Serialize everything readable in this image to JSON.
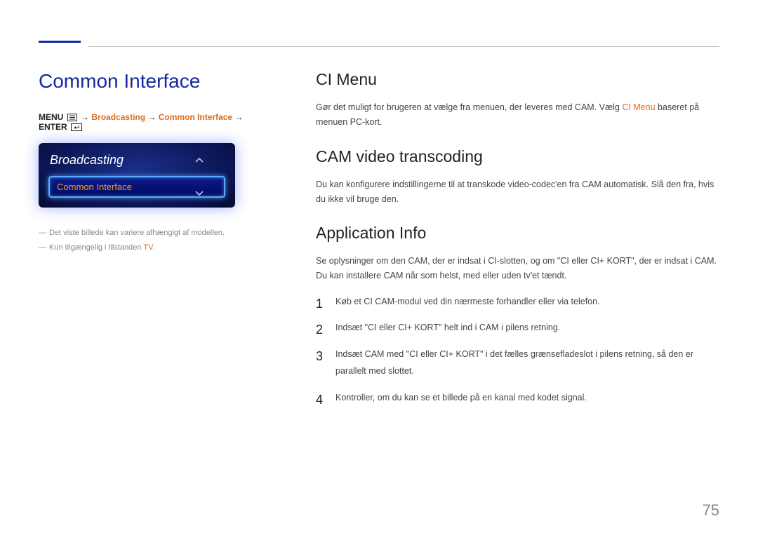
{
  "pageTitle": "Common Interface",
  "breadcrumb": {
    "menu": "MENU",
    "broadcasting": "Broadcasting",
    "commonInterface": "Common Interface",
    "enter": "ENTER",
    "arrow": "→"
  },
  "osd": {
    "title": "Broadcasting",
    "selected": "Common Interface"
  },
  "notes": {
    "dash": "―",
    "n1": "Det viste billede kan variere afhængigt af modellen.",
    "n2a": "Kun tilgængelig i tilstanden ",
    "n2b": "TV",
    "n2c": "."
  },
  "sections": {
    "ciMenu": {
      "heading": "CI Menu",
      "p_a": "Gør det muligt for brugeren at vælge fra menuen, der leveres med CAM. Vælg ",
      "p_b": "CI Menu",
      "p_c": " baseret på menuen PC-kort."
    },
    "camVideo": {
      "heading": "CAM video transcoding",
      "p": "Du kan konfigurere indstillingerne til at transkode video-codec'en fra CAM automatisk. Slå den fra, hvis du ikke vil bruge den."
    },
    "appInfo": {
      "heading": "Application Info",
      "p": "Se oplysninger om den CAM, der er indsat i CI-slotten, og om \"CI eller CI+ KORT\", der er indsat i CAM. Du kan installere CAM når som helst, med eller uden tv'et tændt.",
      "steps": [
        "Køb et CI CAM-modul ved din nærmeste forhandler eller via telefon.",
        "Indsæt \"CI eller CI+ KORT\" helt ind i CAM i pilens retning.",
        "Indsæt CAM med \"CI eller CI+ KORT\" i det fælles grænsefladeslot i pilens retning, så den er parallelt med slottet.",
        "Kontroller, om du kan se et billede på en kanal med kodet signal."
      ]
    }
  },
  "pageNumber": "75"
}
